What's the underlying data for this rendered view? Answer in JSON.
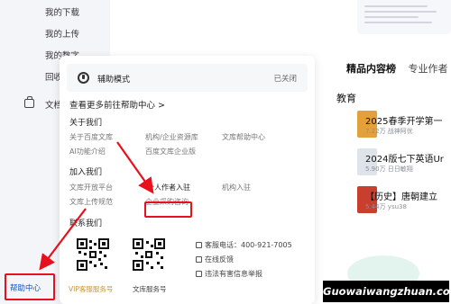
{
  "sidebar": {
    "items": [
      {
        "label": "我的下载"
      },
      {
        "label": "我的上传"
      },
      {
        "label": "我的数字"
      },
      {
        "label": "回收站"
      },
      {
        "label": "文档"
      }
    ],
    "help_center": "帮助中心"
  },
  "popup": {
    "assist_mode": {
      "label": "辅助模式",
      "status": "已关闭"
    },
    "help_link": "查看更多前往帮助中心 >",
    "about": {
      "title": "关于我们",
      "links": [
        "关于百度文库",
        "机构/企业资源库",
        "文库帮助中心",
        "AI功能介绍",
        "百度文库企业版"
      ]
    },
    "join": {
      "title": "加入我们",
      "links": [
        "文库开放平台",
        "个人作者入驻",
        "机构入驻",
        "文库上传规范",
        "企业采购咨询"
      ]
    },
    "contact": {
      "title": "联系我们",
      "qr_captions": [
        "VIP客服服务号",
        "文库服务号"
      ],
      "phone": "客服电话：400-921-7005",
      "online": "在线反馈",
      "report": "违法有害信息举报"
    }
  },
  "content": {
    "tabs": [
      "精品内容榜",
      "专业作者"
    ],
    "section": "教育",
    "books": [
      {
        "title": "2025春季开学第一",
        "meta": "7.22万  战神阿优"
      },
      {
        "title": "2024版七下英语Ur",
        "meta": "5.90万  日日敏翔"
      },
      {
        "title": "【历史】唐朝建立",
        "meta": "5.44万  ysu38"
      }
    ]
  },
  "watermark": "Guowaiwangzhuan.com",
  "colors": {
    "annotation_red": "#e8101d",
    "link_blue": "#1554c2",
    "vip_gold": "#c9953e"
  }
}
